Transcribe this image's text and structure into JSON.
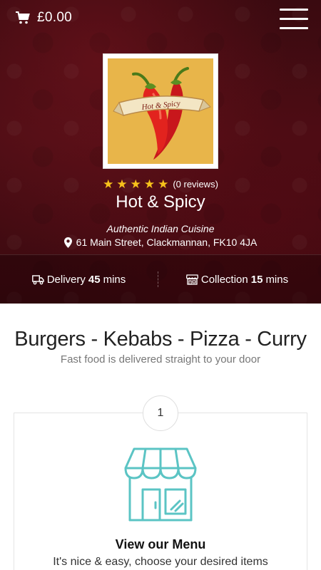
{
  "header": {
    "cart_total": "£0.00",
    "icons": {
      "cart": "shopping-cart-icon",
      "menu": "hamburger-menu-icon"
    }
  },
  "restaurant": {
    "logo_text": "Hot & Spicy",
    "rating_stars": 5,
    "reviews": "(0 reviews)",
    "name": "Hot & Spicy",
    "cuisine": "Authentic Indian Cuisine",
    "address": "61 Main Street, Clackmannan, FK10 4JA"
  },
  "info": {
    "delivery_label": "Delivery",
    "delivery_time": "45",
    "delivery_unit": "mins",
    "collection_label": "Collection",
    "collection_time": "15",
    "collection_unit": "mins"
  },
  "section": {
    "title": "Burgers - Kebabs - Pizza - Curry",
    "subtitle": "Fast food is delivered straight to your door"
  },
  "steps": [
    {
      "number": "1",
      "title": "View our Menu",
      "text": "It's nice & easy, choose your desired items"
    }
  ],
  "colors": {
    "hero_bg": "#4a0d14",
    "star": "#f7c21b",
    "shop_icon": "#5bc4c4",
    "logo_bg": "#e8b54a"
  }
}
